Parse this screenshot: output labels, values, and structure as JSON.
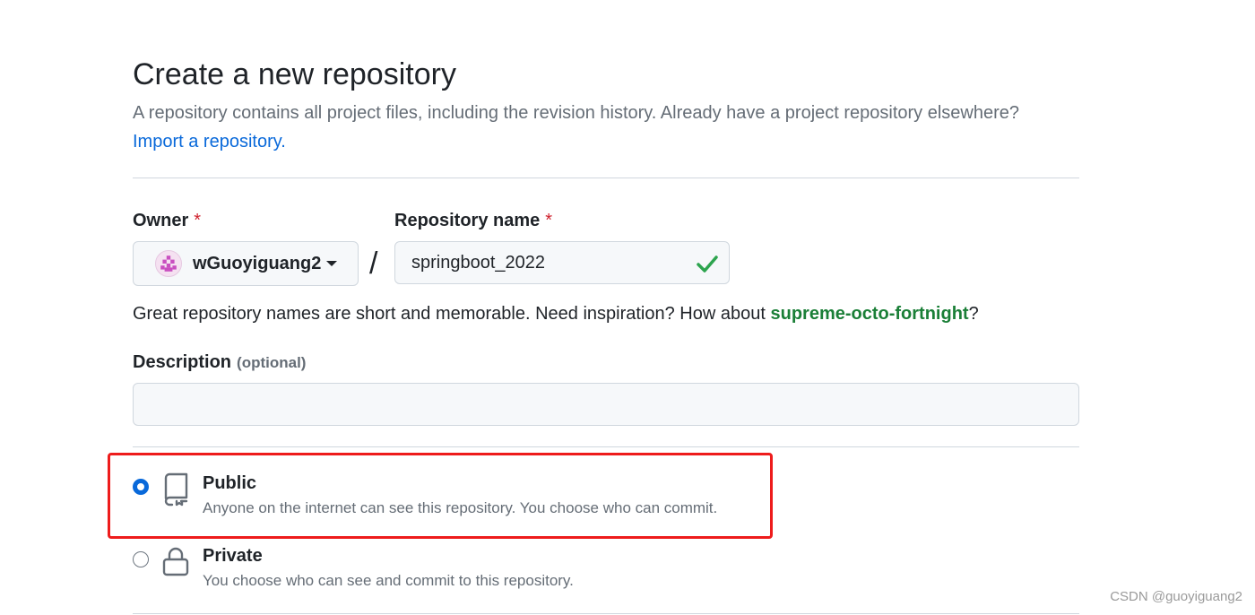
{
  "header": {
    "title": "Create a new repository",
    "subtitle": "A repository contains all project files, including the revision history. Already have a project repository elsewhere?",
    "import_link": "Import a repository."
  },
  "owner": {
    "label": "Owner",
    "required_mark": "*",
    "value": "wGuoyiguang2"
  },
  "separator": "/",
  "repo_name": {
    "label": "Repository name",
    "required_mark": "*",
    "value": "springboot_2022"
  },
  "hint": {
    "prefix": "Great repository names are short and memorable. Need inspiration? How about ",
    "suggestion": "supreme-octo-fortnight",
    "suffix": "?"
  },
  "description": {
    "label": "Description",
    "optional": "(optional)",
    "value": ""
  },
  "visibility": {
    "options": [
      {
        "title": "Public",
        "desc": "Anyone on the internet can see this repository. You choose who can commit.",
        "selected": true,
        "icon": "repo-icon"
      },
      {
        "title": "Private",
        "desc": "You choose who can see and commit to this repository.",
        "selected": false,
        "icon": "lock-icon"
      }
    ]
  },
  "watermark": "CSDN @guoyiguang2",
  "colors": {
    "link": "#0969da",
    "success": "#1a7f37",
    "required": "#cf222e",
    "highlight": "#ee1c1c"
  }
}
